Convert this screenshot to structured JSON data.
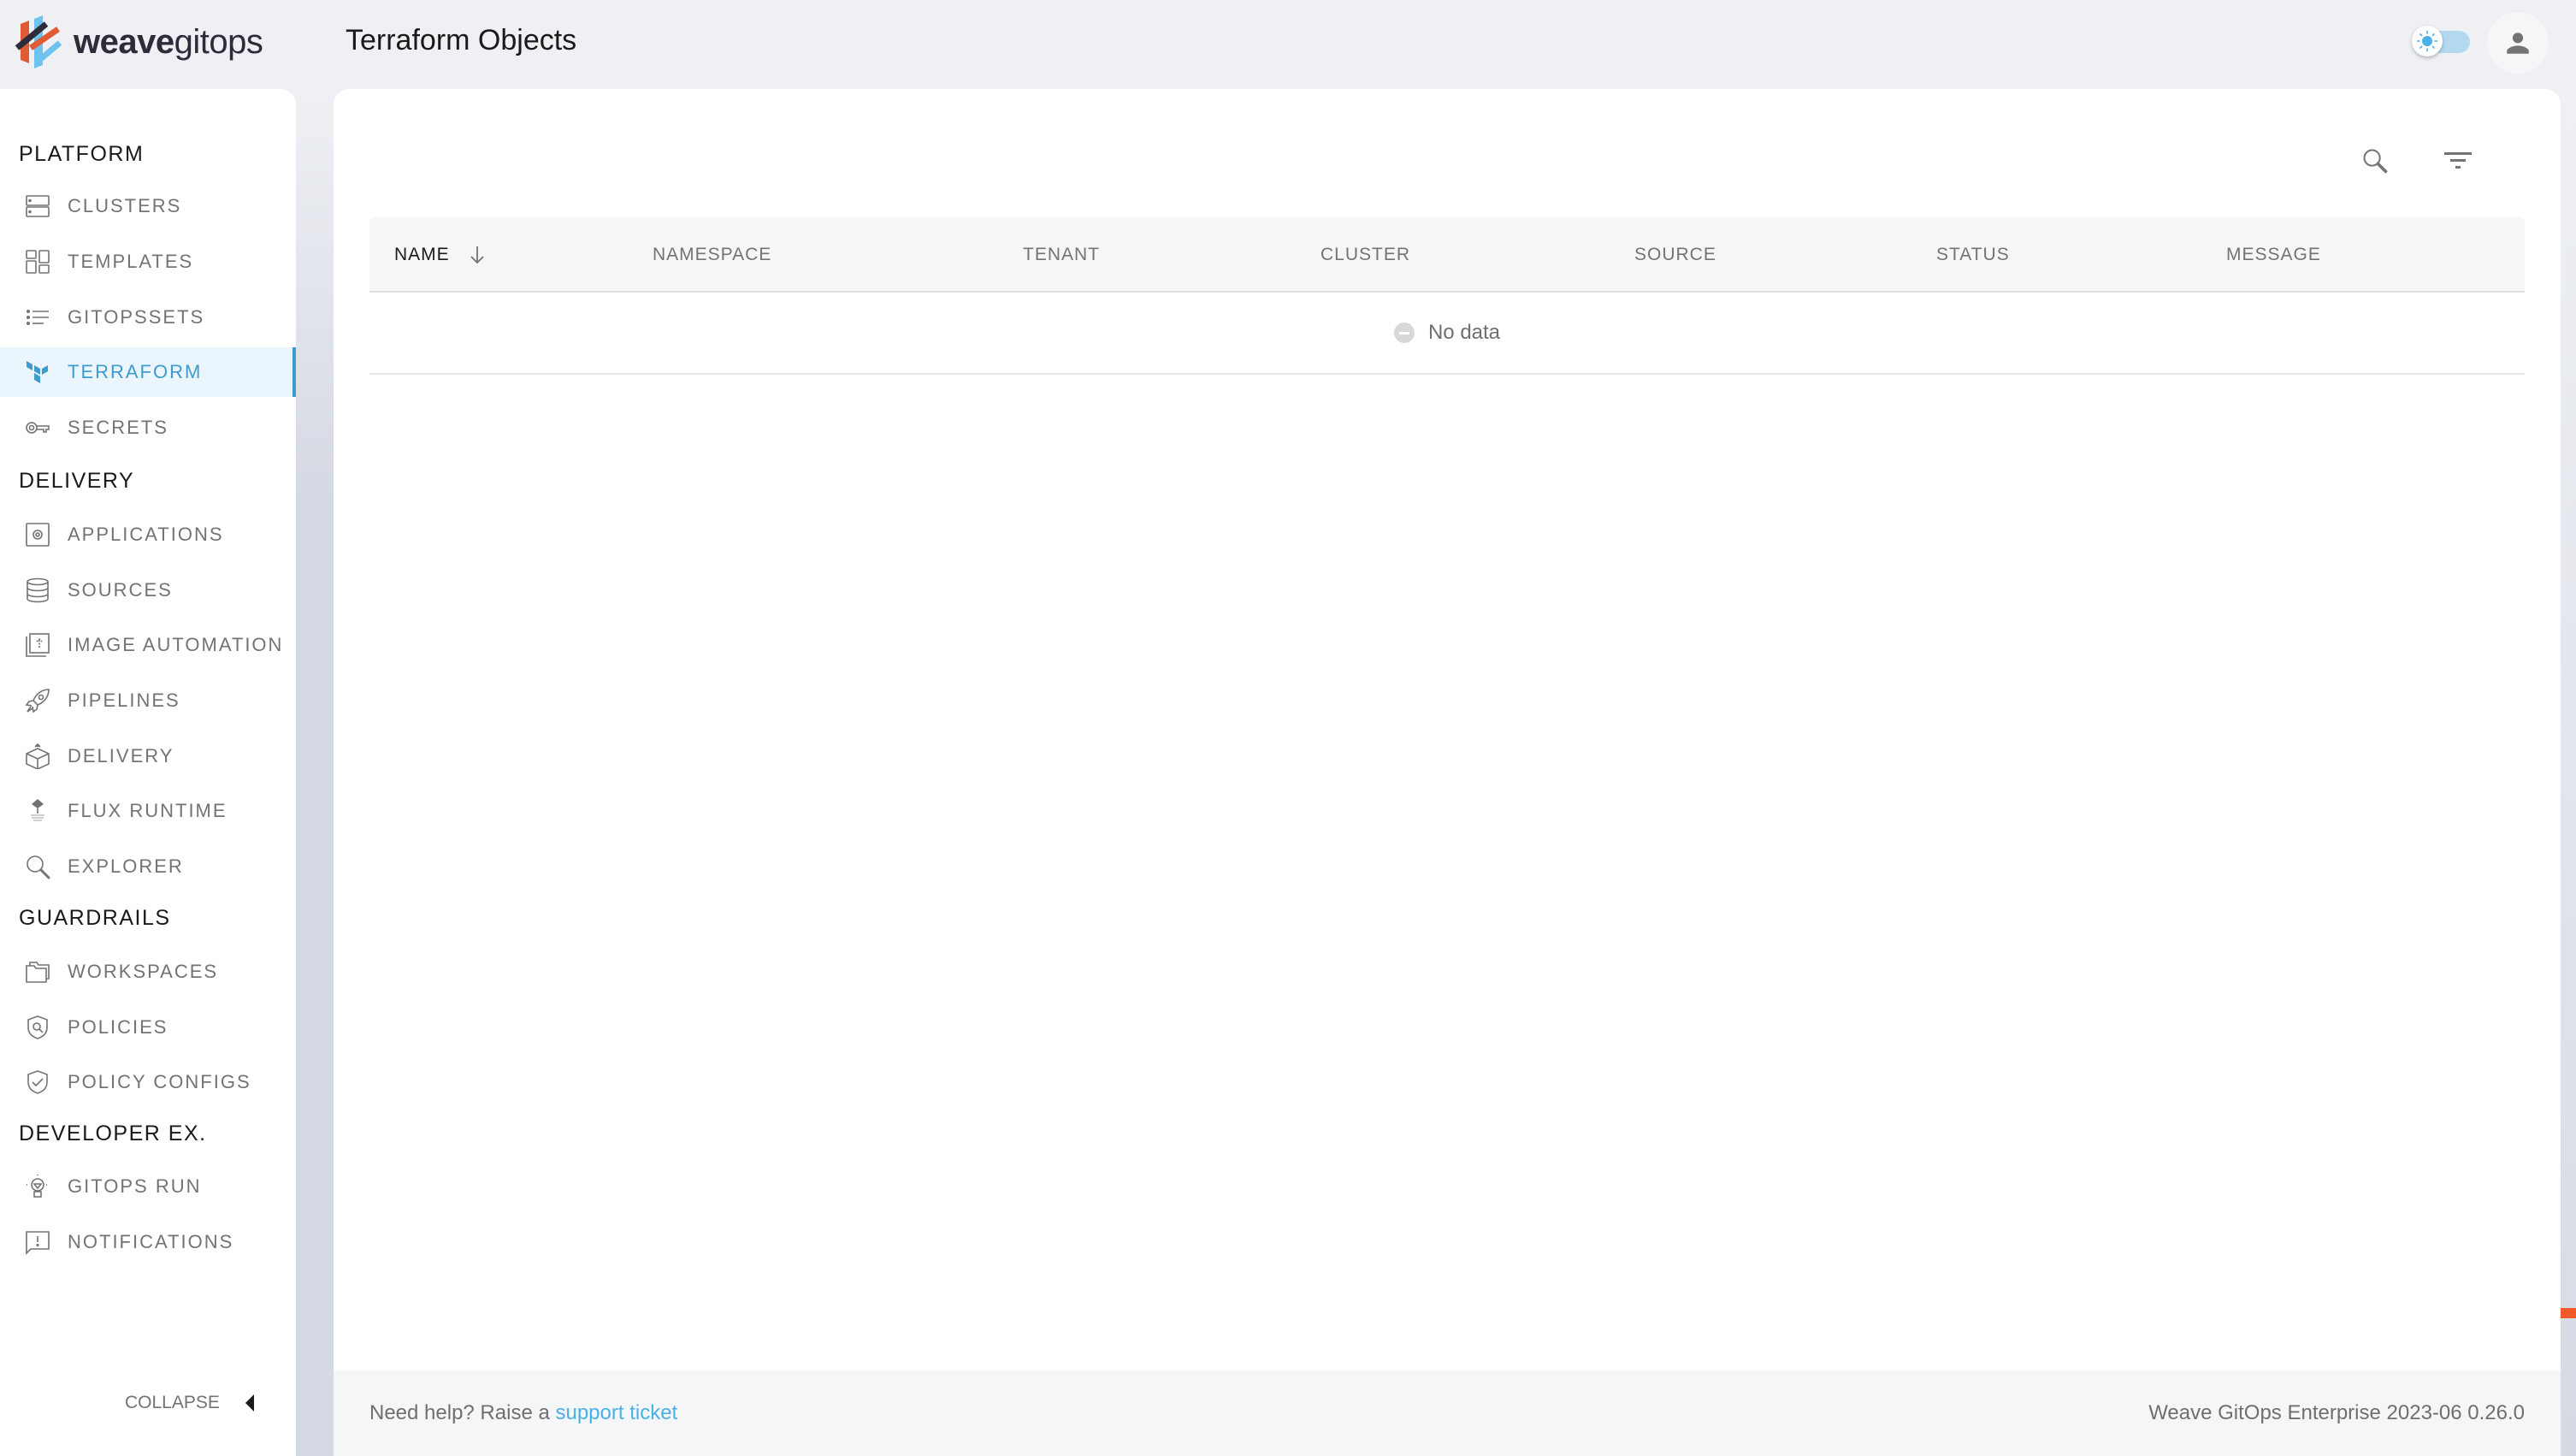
{
  "app": {
    "logo_bold": "weave",
    "logo_light": "gitops",
    "page_title": "Terraform Objects",
    "theme_toggle": {
      "mode": "light",
      "icon": "sun-icon"
    },
    "user_icon": "account-icon"
  },
  "colors": {
    "accent": "#3d9bce",
    "link": "#4ab1e6",
    "brand_orange": "#f05a28",
    "brand_dark": "#2d2d3a",
    "brand_blue": "#6cc3ee"
  },
  "sidebar": {
    "sections": [
      {
        "title": "PLATFORM",
        "items": [
          {
            "label": "CLUSTERS",
            "icon": "clusters-icon"
          },
          {
            "label": "TEMPLATES",
            "icon": "templates-icon"
          },
          {
            "label": "GITOPSSETS",
            "icon": "list-icon"
          },
          {
            "label": "TERRAFORM",
            "icon": "terraform-icon",
            "active": true
          },
          {
            "label": "SECRETS",
            "icon": "key-icon"
          }
        ]
      },
      {
        "title": "DELIVERY",
        "items": [
          {
            "label": "APPLICATIONS",
            "icon": "applications-icon"
          },
          {
            "label": "SOURCES",
            "icon": "database-icon"
          },
          {
            "label": "IMAGE AUTOMATION",
            "icon": "image-automation-icon"
          },
          {
            "label": "PIPELINES",
            "icon": "rocket-icon"
          },
          {
            "label": "DELIVERY",
            "icon": "box-icon"
          },
          {
            "label": "FLUX RUNTIME",
            "icon": "flux-icon"
          },
          {
            "label": "EXPLORER",
            "icon": "search-icon"
          }
        ]
      },
      {
        "title": "GUARDRAILS",
        "items": [
          {
            "label": "WORKSPACES",
            "icon": "folders-icon"
          },
          {
            "label": "POLICIES",
            "icon": "shield-search-icon"
          },
          {
            "label": "POLICY CONFIGS",
            "icon": "shield-check-icon"
          }
        ]
      },
      {
        "title": "DEVELOPER EX.",
        "items": [
          {
            "label": "GITOPS RUN",
            "icon": "lightbulb-icon"
          },
          {
            "label": "NOTIFICATIONS",
            "icon": "notification-icon"
          }
        ]
      }
    ],
    "collapse_label": "COLLAPSE"
  },
  "toolbar": {
    "search_icon": "search-icon",
    "filter_icon": "filter-icon"
  },
  "table": {
    "columns": [
      {
        "label": "NAME",
        "sorted": "desc"
      },
      {
        "label": "NAMESPACE"
      },
      {
        "label": "TENANT"
      },
      {
        "label": "CLUSTER"
      },
      {
        "label": "SOURCE"
      },
      {
        "label": "STATUS"
      },
      {
        "label": "MESSAGE"
      }
    ],
    "rows": [],
    "empty_text": "No data"
  },
  "footer": {
    "help_text": "Need help? Raise a ",
    "help_link": "support ticket",
    "version": "Weave GitOps Enterprise 2023-06 0.26.0"
  }
}
